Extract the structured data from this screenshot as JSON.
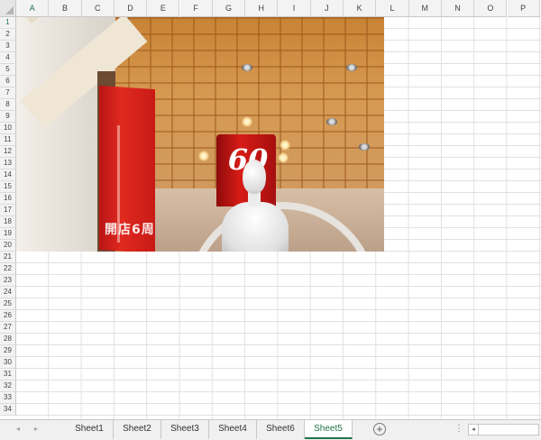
{
  "columns": [
    "A",
    "B",
    "C",
    "D",
    "E",
    "F",
    "G",
    "H",
    "I",
    "J",
    "K",
    "L",
    "M",
    "N",
    "O",
    "P"
  ],
  "rows": [
    "1",
    "2",
    "3",
    "4",
    "5",
    "6",
    "7",
    "8",
    "9",
    "10",
    "11",
    "12",
    "13",
    "14",
    "15",
    "16",
    "17",
    "18",
    "19",
    "20",
    "21",
    "22",
    "23",
    "24",
    "25",
    "26",
    "27",
    "28",
    "29",
    "30",
    "31",
    "32",
    "33",
    "34"
  ],
  "picture": {
    "banner_number": "60",
    "banner_side_text": "開店6周"
  },
  "sheets": [
    {
      "label": "Sheet1"
    },
    {
      "label": "Sheet2"
    },
    {
      "label": "Sheet3"
    },
    {
      "label": "Sheet4"
    },
    {
      "label": "Sheet6"
    },
    {
      "label": "Sheet5"
    }
  ],
  "active_sheet": "Sheet5",
  "tabbar": {
    "add_symbol": "+",
    "more_symbol": "⋮",
    "scroll_left_symbol": "◂",
    "nav_prev_symbol": "◂",
    "nav_next_symbol": "▸"
  },
  "colors": {
    "accent": "#217346",
    "banner_red": "#d71c17"
  }
}
